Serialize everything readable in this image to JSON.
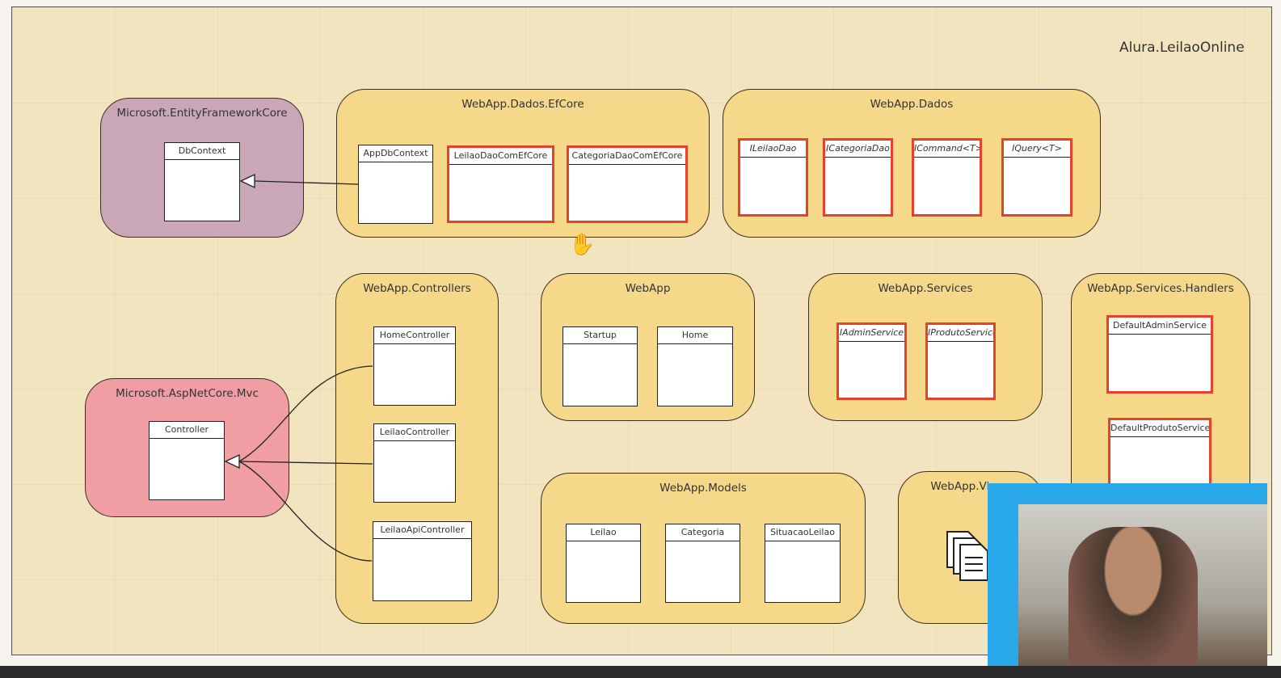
{
  "title": "Alura.LeilaoOnline",
  "colors": {
    "package": "#f6d88a",
    "ef_package": "#c9a7b8",
    "mvc_package": "#f09ea4",
    "highlight_border": "#e8412a",
    "canvas": "#f3e4c0"
  },
  "packages": {
    "ef": {
      "name": "Microsoft.EntityFrameworkCore",
      "classes": [
        "DbContext"
      ]
    },
    "dados_efcore": {
      "name": "WebApp.Dados.EfCore",
      "classes": [
        "AppDbContext",
        "LeilaoDaoComEfCore",
        "CategoriaDaoComEfCore"
      ]
    },
    "dados": {
      "name": "WebApp.Dados",
      "classes": [
        "ILeilaoDao",
        "ICategoriaDao",
        "ICommand<T>",
        "IQuery<T>"
      ]
    },
    "controllers": {
      "name": "WebApp.Controllers",
      "classes": [
        "HomeController",
        "LeilaoController",
        "LeilaoApiController"
      ]
    },
    "mvc": {
      "name": "Microsoft.AspNetCore.Mvc",
      "classes": [
        "Controller"
      ]
    },
    "webapp": {
      "name": "WebApp",
      "classes": [
        "Startup",
        "Home"
      ]
    },
    "services": {
      "name": "WebApp.Services",
      "classes": [
        "IAdminService",
        "IProdutoService"
      ]
    },
    "handlers": {
      "name": "WebApp.Services.Handlers",
      "classes": [
        "DefaultAdminService",
        "DefaultProdutoService"
      ]
    },
    "models": {
      "name": "WebApp.Models",
      "classes": [
        "Leilao",
        "Categoria",
        "SituacaoLeilao"
      ]
    },
    "views": {
      "name": "WebApp.Views",
      "icon": "documents-icon"
    }
  },
  "relations": [
    {
      "from": "AppDbContext",
      "to": "DbContext",
      "type": "inheritance"
    },
    {
      "from": "HomeController",
      "to": "Controller",
      "type": "inheritance"
    },
    {
      "from": "LeilaoController",
      "to": "Controller",
      "type": "inheritance"
    },
    {
      "from": "LeilaoApiController",
      "to": "Controller",
      "type": "inheritance"
    }
  ]
}
